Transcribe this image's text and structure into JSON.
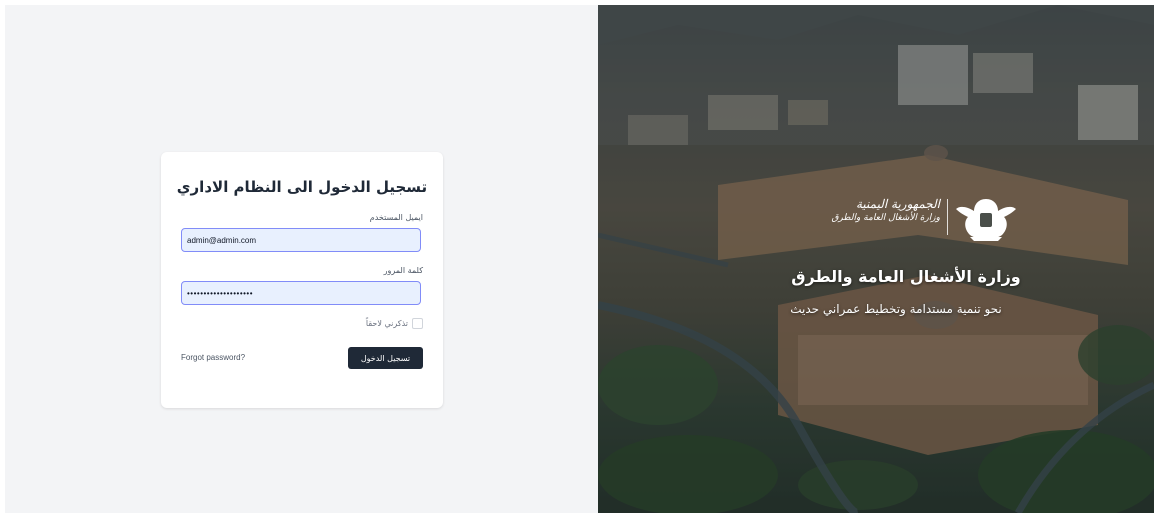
{
  "login": {
    "title": "تسجيل الدخول الى النظام الاداري",
    "email_label": "ايميل المستخدم",
    "email_value": "admin@admin.com",
    "password_label": "كلمة المرور",
    "password_value": "••••••••••••••••••••",
    "remember_label": "تذكرني لاحقاً",
    "forgot_label": "Forgot password?",
    "submit_label": "تسجيل الدخول"
  },
  "brand": {
    "logo_line_1": "الجمهورية اليمنية",
    "logo_line_2": "وزارة الأشغال العامة والطرق",
    "ministry_name": "وزارة الأشغال العامة والطرق",
    "tagline": "نحو تنمية مستدامة وتخطيط عمراني حديث"
  },
  "icons": {
    "emblem": "yemen-eagle-emblem-icon",
    "checkbox": "checkbox-icon"
  },
  "colors": {
    "page_bg": "#f3f4f6",
    "card_bg": "#ffffff",
    "input_bg": "#e8f0fe",
    "input_border": "#818cf8",
    "button_bg": "#1f2937",
    "text_dark": "#1f2937"
  }
}
